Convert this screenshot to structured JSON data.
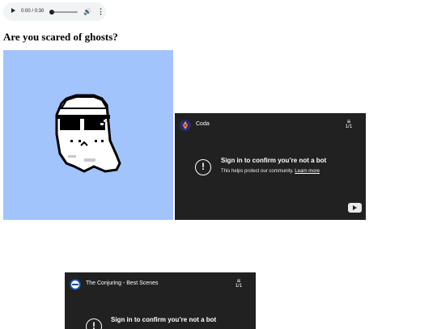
{
  "audio": {
    "time": "0:00 / 0:30",
    "progress": 0.0,
    "play_icon": "play-icon",
    "volume_icon": "volume-icon",
    "more_icon": "more-vert-icon"
  },
  "heading": "Are you scared of ghosts?",
  "panel_color": "#a2c4fd",
  "embeds": [
    {
      "channel": "Coda",
      "playlist_count": "1/1",
      "message_title": "Sign in to confirm you’re not a bot",
      "message_sub": "This helps protect our community.",
      "learn_more": "Learn more"
    },
    {
      "channel": "The Conjuring - Best Scenes",
      "playlist_count": "1/1",
      "message_title": "Sign in to confirm you’re not a bot"
    }
  ]
}
